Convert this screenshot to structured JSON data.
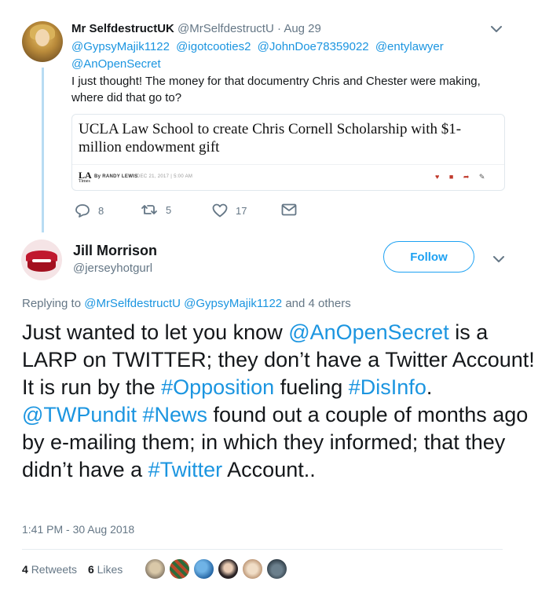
{
  "tweet1": {
    "name": "Mr SelfdestructUK",
    "handle": "@MrSelfdestructU",
    "separator": "·",
    "date": "Aug 29",
    "mentions": [
      "@GypsyMajik1122",
      "@igotcooties2",
      "@JohnDoe78359022",
      "@entylawyer",
      "@AnOpenSecret"
    ],
    "text": "I just thought! The money for that documentry Chris and Chester were making, where did that go to?",
    "card": {
      "title": "UCLA Law School to create Chris Cornell Scholarship with $1-million endowment gift",
      "logo": "LA",
      "logo_sub": "Times",
      "byline": "By RANDY LEWIS",
      "date": "DEC 21, 2017  |  5:00 AM",
      "share_icons": [
        "twitter-icon",
        "facebook-icon",
        "share-icon",
        "edit-icon"
      ]
    },
    "actions": {
      "replies": "8",
      "retweets": "5",
      "likes": "17"
    }
  },
  "tweet2": {
    "name": "Jill Morrison",
    "handle": "@jerseyhotgurl",
    "follow_label": "Follow",
    "reply_prefix": "Replying to",
    "reply_mention1": "@MrSelfdestructU",
    "reply_mention2": "@GypsyMajik1122",
    "reply_suffix": "and 4 others",
    "text_parts": {
      "p1": "Just wanted to let you know ",
      "l1": "@AnOpenSecret",
      "p2": " is a LARP on TWITTER; they don’t have a Twitter Account! It is run by the ",
      "l2": "#Opposition",
      "p3": " fueling ",
      "l3": "#DisInfo",
      "p4": ". ",
      "l4": "@TWPundit",
      "p5": " ",
      "l5": "#News",
      "p6": " found out a couple of months ago by e-mailing them; in which they informed; that they didn’t have a ",
      "l6": "#Twitter",
      "p7": " Account.."
    },
    "timestamp": "1:41 PM - 30 Aug 2018",
    "retweet_count": "4",
    "retweet_label": "Retweets",
    "like_count": "6",
    "like_label": "Likes"
  },
  "colors": {
    "link": "#1b95e0",
    "muted": "#657786",
    "thread_line": "#b8dcf3",
    "follow": "#1da1f2"
  }
}
